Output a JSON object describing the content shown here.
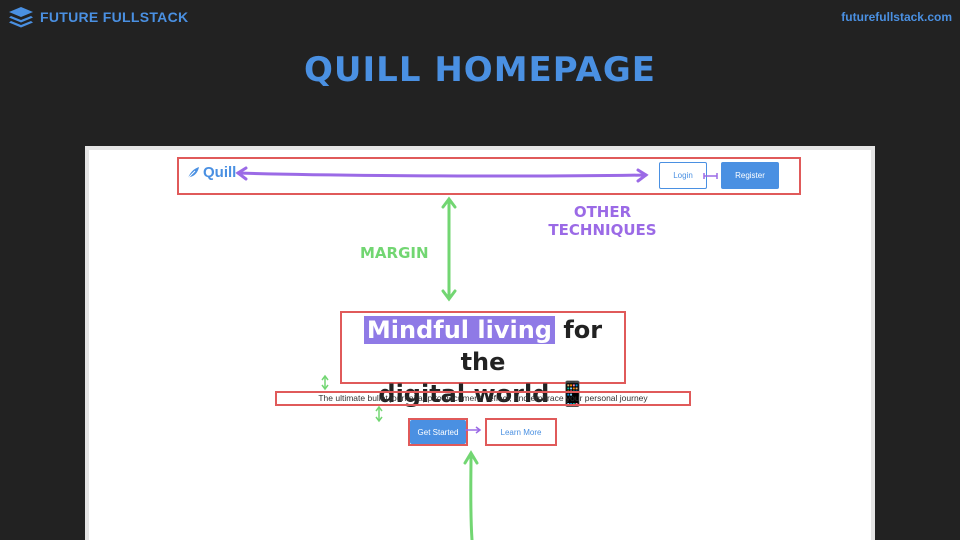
{
  "header": {
    "brand": "FUTURE FULLSTACK",
    "url": "futurefullstack.com",
    "title": "QUILL HOMEPAGE"
  },
  "quill": {
    "logo": "Quill",
    "login": "Login",
    "register": "Register",
    "headline_highlight": "Mindful living",
    "headline_rest": "for the",
    "headline_line2": "digital world",
    "headline_emoji": "📱",
    "subtext": "The ultimate bullet journal app to document, reflect, and embrace your personal journey",
    "get_started": "Get Started",
    "learn_more": "Learn More"
  },
  "annotations": {
    "margin": "MARGIN",
    "other_line1": "OTHER",
    "other_line2": "TECHNIQUES"
  },
  "colors": {
    "background": "#222222",
    "accent_blue": "#4a90e2",
    "highlight_purple": "#8f7ae6",
    "outline_red": "#e05a5a",
    "annotation_green": "#72d672",
    "annotation_purple": "#9b6ae6"
  },
  "icons": {
    "brand": "stacked-layers-icon",
    "logo": "feather-icon"
  }
}
